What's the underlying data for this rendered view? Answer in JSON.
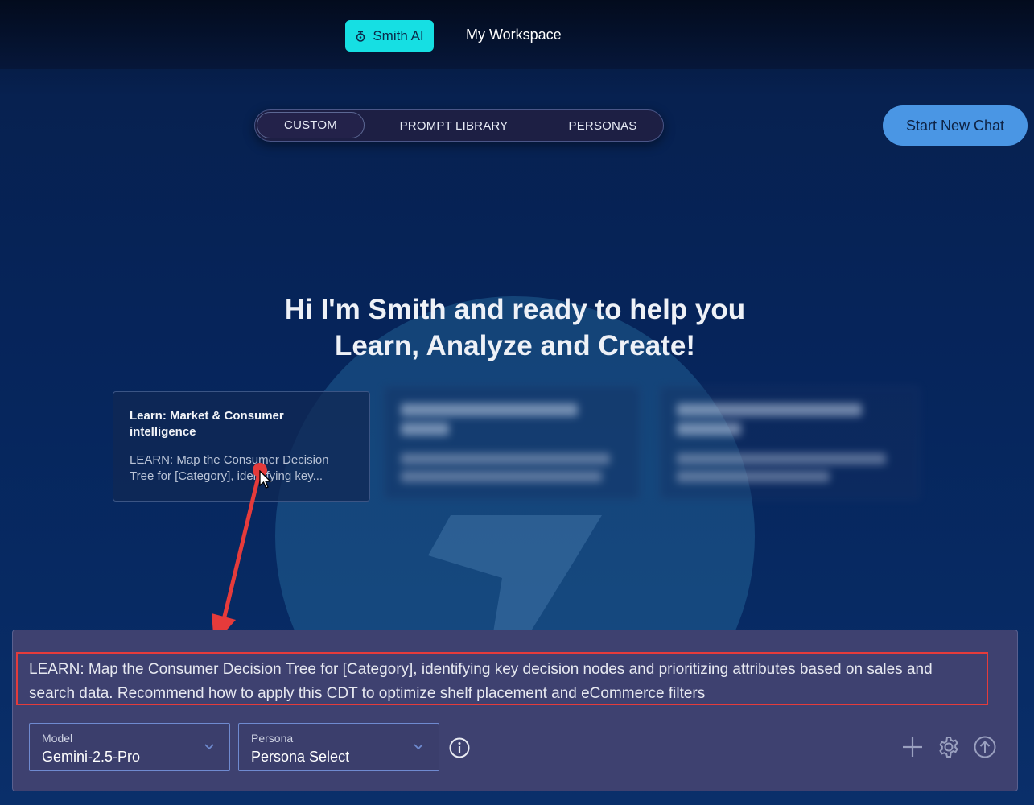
{
  "nav": {
    "active_label": "Smith AI",
    "workspace_label": "My Workspace"
  },
  "tabs": [
    {
      "label": "CUSTOM",
      "active": true
    },
    {
      "label": "PROMPT LIBRARY",
      "active": false
    },
    {
      "label": "PERSONAS",
      "active": false
    }
  ],
  "new_chat_label": "Start New Chat",
  "hero": {
    "line1": "Hi I'm Smith and ready to help you",
    "line2": "Learn, Analyze and Create!"
  },
  "card": {
    "title": "Learn: Market & Consumer intelligence",
    "desc": "LEARN: Map the Consumer Decision Tree for [Category], identifying key..."
  },
  "composer": {
    "prompt_text": "LEARN: Map the Consumer Decision Tree for [Category], identifying key decision nodes and prioritizing attributes based on sales and search data. Recommend how to apply this CDT to optimize shelf placement and eCommerce filters",
    "model_label": "Model",
    "model_value": "Gemini-2.5-Pro",
    "persona_label": "Persona",
    "persona_value": "Persona Select"
  },
  "colors": {
    "accent_cyan": "#16dfe3",
    "button_blue": "#4a96e4",
    "annotation_red": "#e53b3b"
  }
}
